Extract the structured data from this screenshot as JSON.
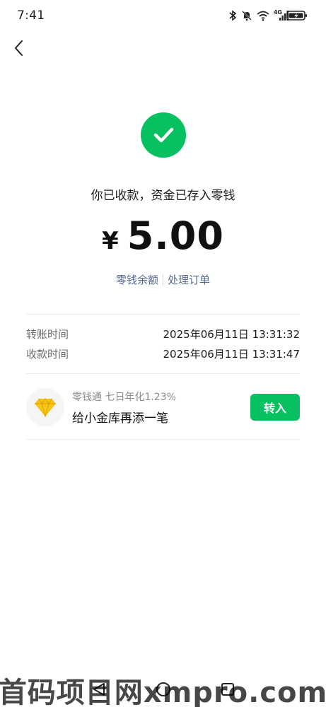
{
  "status_bar": {
    "time": "7:41",
    "icons": [
      "bluetooth-icon",
      "mute-bell-icon",
      "wifi-icon",
      "signal-4g-icon",
      "battery-charging-icon"
    ],
    "network_label": "4G"
  },
  "header": {
    "back_icon": "chevron-left-icon"
  },
  "result": {
    "icon": "check-circle-icon",
    "icon_color": "#07c160",
    "message": "你已收款，资金已存入零钱",
    "currency_symbol": "¥",
    "amount": "5.00"
  },
  "links": {
    "balance": "零钱余额",
    "process_order": "处理订单",
    "link_color": "#576b95"
  },
  "details": [
    {
      "label": "转账时间",
      "value": "2025年06月11日 13:31:32"
    },
    {
      "label": "收款时间",
      "value": "2025年06月11日 13:31:47"
    }
  ],
  "promo": {
    "icon": "diamond-icon",
    "subtitle": "零钱通 七日年化1.23%",
    "title": "给小金库再添一笔",
    "button_label": "转入",
    "button_color": "#07c160"
  },
  "nav_bar": {
    "icons": [
      "back-triangle-icon",
      "home-circle-icon",
      "recents-square-icon"
    ]
  },
  "watermark": {
    "text": "首码项目网xmpro.com"
  }
}
